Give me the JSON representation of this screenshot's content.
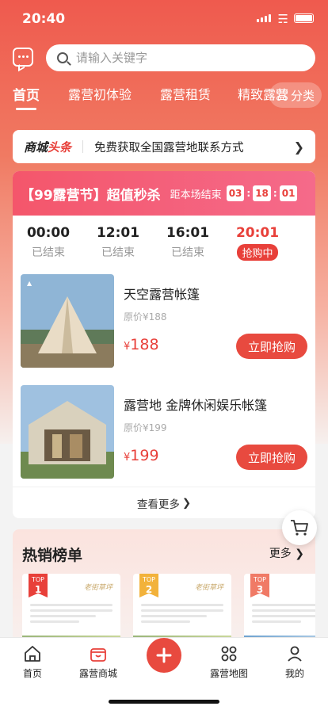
{
  "status": {
    "time": "20:40"
  },
  "search": {
    "placeholder": "请输入关键字"
  },
  "tabs": [
    "首页",
    "露营初体验",
    "露营租赁",
    "精致露营"
  ],
  "category_label": "分类",
  "headline": {
    "brand_prefix": "商城",
    "brand_suffix": "头条",
    "text": "免费获取全国露营地联系方式"
  },
  "flash_sale": {
    "title": "【99露营节】超值秒杀",
    "end_label": "距本场结束",
    "countdown": [
      "03",
      "18",
      "01"
    ],
    "slots": [
      {
        "time": "00:00",
        "status": "已结束"
      },
      {
        "time": "12:01",
        "status": "已结束"
      },
      {
        "time": "16:01",
        "status": "已结束"
      },
      {
        "time": "20:01",
        "status": "抢购中"
      }
    ],
    "products": [
      {
        "name": "天空露营帐篷",
        "original": "原价¥188",
        "currency": "¥",
        "price": "188",
        "button": "立即抢购"
      },
      {
        "name": "露营地 金牌休闲娱乐帐篷",
        "original": "原价¥199",
        "currency": "¥",
        "price": "199",
        "button": "立即抢购"
      }
    ],
    "more": "查看更多"
  },
  "hot_list": {
    "title": "热销榜单",
    "more": "更多",
    "cards": [
      {
        "badge_top": "TOP",
        "badge_num": "1",
        "brand": "老街草坪"
      },
      {
        "badge_top": "TOP",
        "badge_num": "2",
        "brand": "老街草坪"
      },
      {
        "badge_top": "TOP",
        "badge_num": "3",
        "brand": ""
      }
    ]
  },
  "tabbar": [
    "首页",
    "露营商城",
    "露营地图",
    "我的"
  ],
  "colors": {
    "accent": "#e84a3f",
    "hero": "#ef5a4e",
    "flash_head": "#f4566b"
  }
}
